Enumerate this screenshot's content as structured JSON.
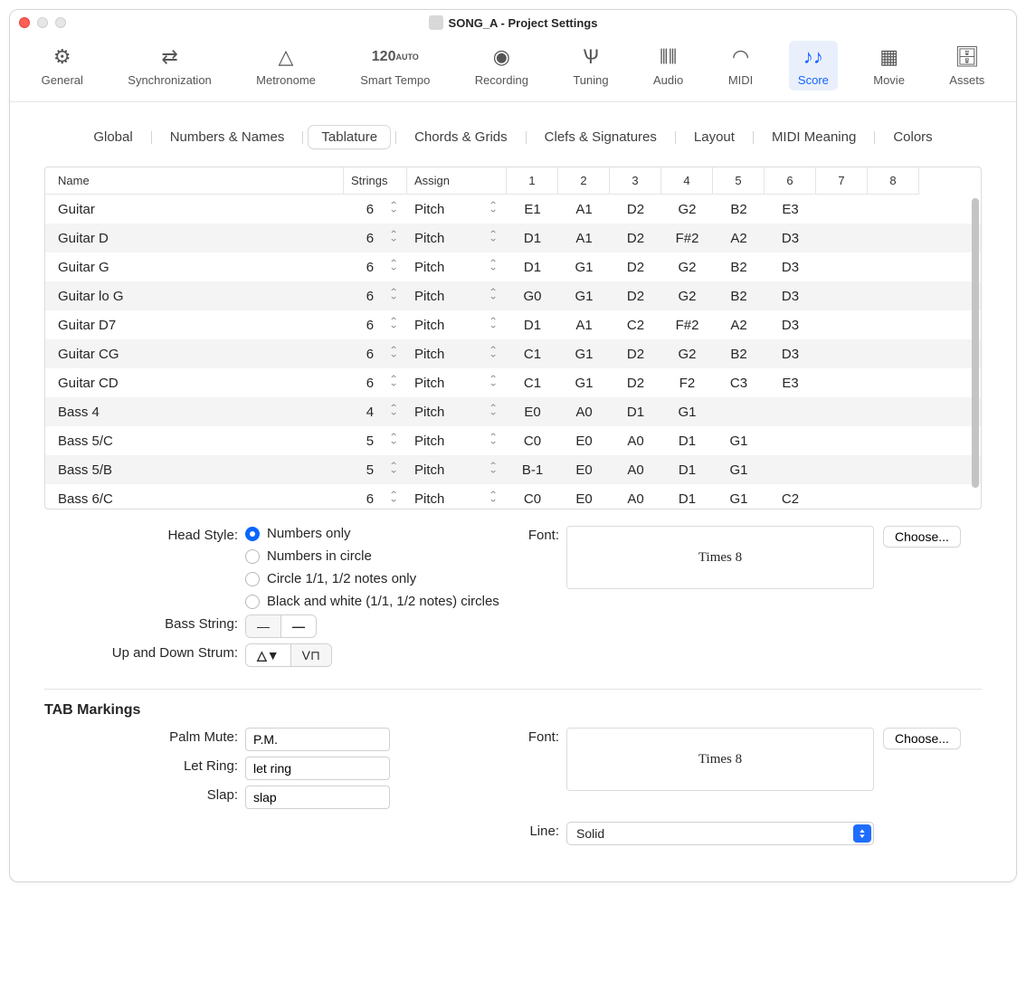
{
  "window": {
    "title": "SONG_A - Project Settings"
  },
  "toolbar": [
    {
      "id": "general",
      "label": "General"
    },
    {
      "id": "sync",
      "label": "Synchronization"
    },
    {
      "id": "metronome",
      "label": "Metronome"
    },
    {
      "id": "smart-tempo",
      "label": "Smart Tempo",
      "main": "120",
      "sub": "AUTO"
    },
    {
      "id": "recording",
      "label": "Recording"
    },
    {
      "id": "tuning",
      "label": "Tuning"
    },
    {
      "id": "audio",
      "label": "Audio"
    },
    {
      "id": "midi",
      "label": "MIDI"
    },
    {
      "id": "score",
      "label": "Score",
      "active": true
    },
    {
      "id": "movie",
      "label": "Movie"
    },
    {
      "id": "assets",
      "label": "Assets"
    }
  ],
  "subtabs": [
    "Global",
    "Numbers & Names",
    "Tablature",
    "Chords & Grids",
    "Clefs & Signatures",
    "Layout",
    "MIDI Meaning",
    "Colors"
  ],
  "subtab_active": "Tablature",
  "table": {
    "headers": {
      "name": "Name",
      "strings": "Strings",
      "assign": "Assign",
      "nums": [
        "1",
        "2",
        "3",
        "4",
        "5",
        "6",
        "7",
        "8"
      ]
    },
    "rows": [
      {
        "name": "Guitar",
        "strings": "6",
        "assign": "Pitch",
        "v": [
          "E1",
          "A1",
          "D2",
          "G2",
          "B2",
          "E3",
          "",
          ""
        ]
      },
      {
        "name": "Guitar D",
        "strings": "6",
        "assign": "Pitch",
        "v": [
          "D1",
          "A1",
          "D2",
          "F#2",
          "A2",
          "D3",
          "",
          ""
        ]
      },
      {
        "name": "Guitar G",
        "strings": "6",
        "assign": "Pitch",
        "v": [
          "D1",
          "G1",
          "D2",
          "G2",
          "B2",
          "D3",
          "",
          ""
        ]
      },
      {
        "name": "Guitar lo G",
        "strings": "6",
        "assign": "Pitch",
        "v": [
          "G0",
          "G1",
          "D2",
          "G2",
          "B2",
          "D3",
          "",
          ""
        ]
      },
      {
        "name": "Guitar D7",
        "strings": "6",
        "assign": "Pitch",
        "v": [
          "D1",
          "A1",
          "C2",
          "F#2",
          "A2",
          "D3",
          "",
          ""
        ]
      },
      {
        "name": "Guitar CG",
        "strings": "6",
        "assign": "Pitch",
        "v": [
          "C1",
          "G1",
          "D2",
          "G2",
          "B2",
          "D3",
          "",
          ""
        ]
      },
      {
        "name": "Guitar CD",
        "strings": "6",
        "assign": "Pitch",
        "v": [
          "C1",
          "G1",
          "D2",
          "F2",
          "C3",
          "E3",
          "",
          ""
        ]
      },
      {
        "name": "Bass 4",
        "strings": "4",
        "assign": "Pitch",
        "v": [
          "E0",
          "A0",
          "D1",
          "G1",
          "",
          "",
          "",
          ""
        ]
      },
      {
        "name": "Bass 5/C",
        "strings": "5",
        "assign": "Pitch",
        "v": [
          "C0",
          "E0",
          "A0",
          "D1",
          "G1",
          "",
          "",
          ""
        ]
      },
      {
        "name": "Bass 5/B",
        "strings": "5",
        "assign": "Pitch",
        "v": [
          "B-1",
          "E0",
          "A0",
          "D1",
          "G1",
          "",
          "",
          ""
        ]
      },
      {
        "name": "Bass 6/C",
        "strings": "6",
        "assign": "Pitch",
        "v": [
          "C0",
          "E0",
          "A0",
          "D1",
          "G1",
          "C2",
          "",
          ""
        ]
      }
    ]
  },
  "form": {
    "head_style_label": "Head Style:",
    "head_style_options": [
      "Numbers only",
      "Numbers in circle",
      "Circle 1/1, 1/2 notes only",
      "Black and white (1/1, 1/2 notes) circles"
    ],
    "head_style_selected": 0,
    "bass_string_label": "Bass String:",
    "strum_label": "Up and Down Strum:",
    "font_label": "Font:",
    "font_preview": "Times 8",
    "choose_label": "Choose..."
  },
  "tab_markings": {
    "heading": "TAB Markings",
    "palm_mute_label": "Palm Mute:",
    "palm_mute_value": "P.M.",
    "let_ring_label": "Let Ring:",
    "let_ring_value": "let ring",
    "slap_label": "Slap:",
    "slap_value": "slap",
    "font_label": "Font:",
    "font_preview": "Times 8",
    "choose_label": "Choose...",
    "line_label": "Line:",
    "line_value": "Solid"
  }
}
